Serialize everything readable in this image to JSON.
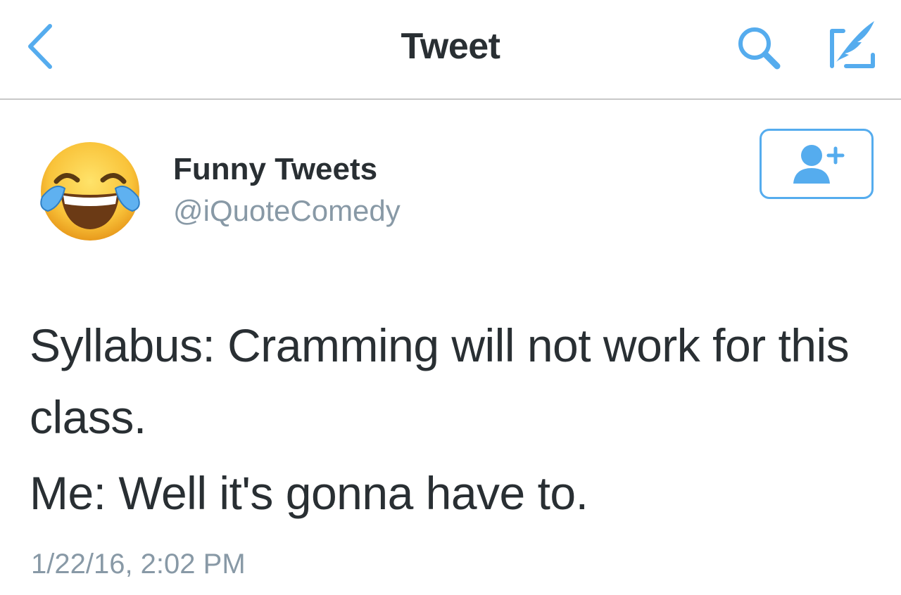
{
  "navbar": {
    "title": "Tweet",
    "back_icon": "chevron-left-icon",
    "search_icon": "search-icon",
    "compose_icon": "compose-tweet-icon",
    "accent": "#55acee"
  },
  "tweet": {
    "author": {
      "display_name": "Funny Tweets",
      "handle": "@iQuoteComedy",
      "avatar_icon": "face-with-tears-of-joy-emoji"
    },
    "follow_icon": "add-user-icon",
    "text_lines": [
      "Syllabus: Cramming will not work for this class.",
      "Me: Well it's gonna have to."
    ],
    "timestamp": "1/22/16, 2:02 PM"
  }
}
